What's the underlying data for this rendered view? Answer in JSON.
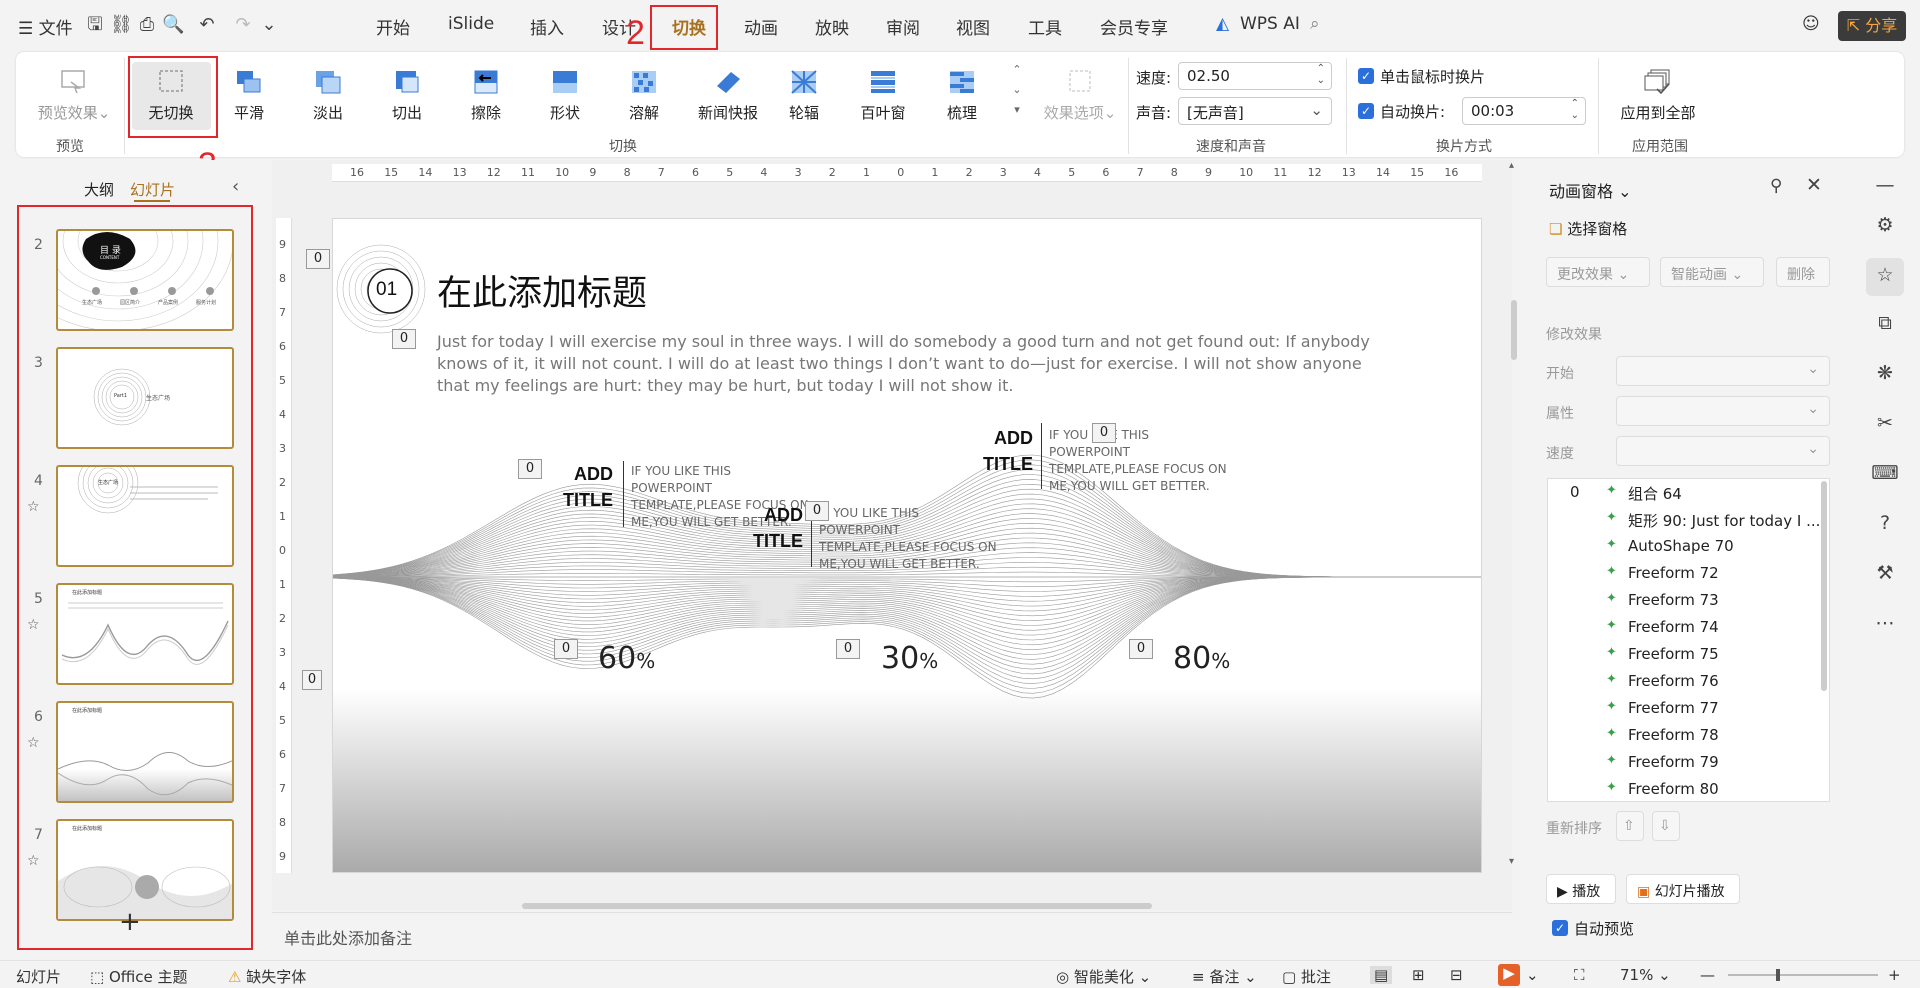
{
  "menu": {
    "file": "文件",
    "tabs": [
      "开始",
      "iSlide",
      "插入",
      "设计",
      "切换",
      "动画",
      "放映",
      "审阅",
      "视图",
      "工具",
      "会员专享"
    ],
    "active_tab": "切换",
    "wps_ai": "WPS AI",
    "share": "分享"
  },
  "ribbon": {
    "preview_btn": "预览效果",
    "preview_group": "预览",
    "transitions": [
      "无切换",
      "平滑",
      "淡出",
      "切出",
      "擦除",
      "形状",
      "溶解",
      "新闻快报",
      "轮辐",
      "百叶窗",
      "梳理"
    ],
    "effect_options": "效果选项",
    "transition_group": "切换",
    "speed_label": "速度:",
    "speed_value": "02.50",
    "sound_label": "声音:",
    "sound_value": "[无声音]",
    "speed_sound_group": "速度和声音",
    "click_advance": "单击鼠标时换片",
    "auto_advance": "自动换片:",
    "auto_value": "00:03",
    "advance_group": "换片方式",
    "apply_all": "应用到全部",
    "apply_group": "应用范围"
  },
  "annotations": {
    "n2": "2",
    "n3": "3"
  },
  "leftpanel": {
    "tab_outline": "大纲",
    "tab_slides": "幻灯片",
    "slide_numbers": [
      "2",
      "3",
      "4",
      "5",
      "6",
      "7"
    ],
    "add": "+"
  },
  "thumb_text": {
    "t2_title": "目 录",
    "t2_sub": "CONTENT",
    "t2_items": [
      "生态广场",
      "园区简介",
      "产品案例",
      "服务计划"
    ],
    "t3_part": "Part1",
    "t3_label": "生态广场",
    "t4_label": "生态广场",
    "t5_title": "在此添加标题",
    "t6_title": "在此添加标题",
    "t7_title": "在此添加标题"
  },
  "slide": {
    "num": "01",
    "title": "在此添加标题",
    "body": "Just for today I will exercise my soul in three ways. I will do somebody a good turn and not get found out: If anybody knows of it, it will not count. I will do at least two things I don’t want to do—just for exercise. I will not show anyone that my feelings are hurt: they may be hurt, but today I will not show it.",
    "items": [
      {
        "head": "ADD\nTITLE",
        "text": "IF YOU LIKE THIS POWERPOINT TEMPLATE,PLEASE FOCUS ON ME,YOU WILL GET BETTER.",
        "pct": "60",
        "pct_value": 60
      },
      {
        "head": "ADD\nTITLE",
        "text": "IF YOU LIKE THIS POWERPOINT TEMPLATE,PLEASE FOCUS ON ME,YOU WILL GET BETTER.",
        "pct": "30",
        "pct_value": 30
      },
      {
        "head": "ADD\nTITLE",
        "text": "IF YOU LIKE THIS POWERPOINT TEMPLATE,PLEASE FOCUS ON ME,YOU WILL GET BETTER.",
        "pct": "80",
        "pct_value": 80
      }
    ],
    "pct_sign": "%",
    "anim_tag": "0"
  },
  "notes_placeholder": "单击此处添加备注",
  "ruler": {
    "h": [
      "16",
      "15",
      "14",
      "13",
      "12",
      "11",
      "10",
      "9",
      "8",
      "7",
      "6",
      "5",
      "4",
      "3",
      "2",
      "1",
      "0",
      "1",
      "2",
      "3",
      "4",
      "5",
      "6",
      "7",
      "8",
      "9",
      "10",
      "11",
      "12",
      "13",
      "14",
      "15",
      "16"
    ],
    "v": [
      "9",
      "8",
      "7",
      "6",
      "5",
      "4",
      "3",
      "2",
      "1",
      "0",
      "1",
      "2",
      "3",
      "4",
      "5",
      "6",
      "7",
      "8",
      "9"
    ]
  },
  "anim_pane": {
    "title": "动画窗格",
    "select_pane": "选择窗格",
    "change_effect": "更改效果",
    "smart_anim": "智能动画",
    "delete": "删除",
    "modify_effect": "修改效果",
    "start": "开始",
    "property": "属性",
    "speed": "速度",
    "list_index": "0",
    "list": [
      "组合 64",
      "矩形 90: Just for today I ...",
      "AutoShape 70",
      "Freeform 72",
      "Freeform 73",
      "Freeform 74",
      "Freeform 75",
      "Freeform 76",
      "Freeform 77",
      "Freeform 78",
      "Freeform 79",
      "Freeform 80"
    ],
    "reorder": "重新排序",
    "play": "播放",
    "slideshow": "幻灯片播放",
    "auto_preview": "自动预览"
  },
  "status": {
    "slides": "幻灯片",
    "theme": "Office 主题",
    "missing_font": "缺失字体",
    "beautify": "智能美化",
    "notes": "备注",
    "comments": "批注",
    "zoom": "71%"
  },
  "colors": {
    "accent_red": "#e1262c",
    "brand_gold": "#b48a3c",
    "check_blue": "#2a6fdb"
  }
}
